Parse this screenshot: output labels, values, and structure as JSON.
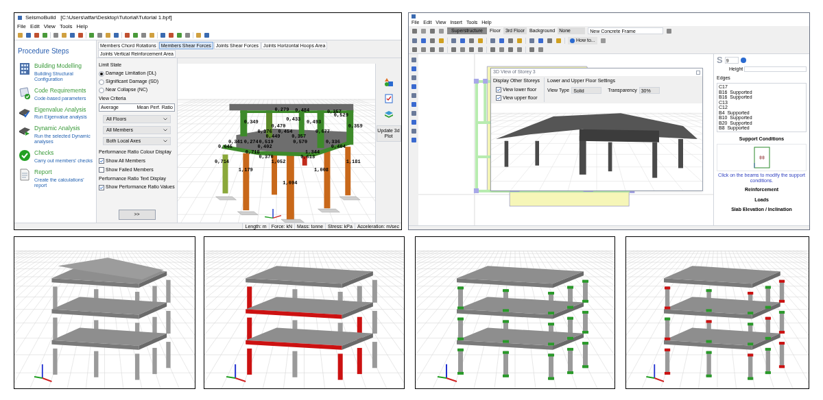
{
  "left_window": {
    "title": "SeismoBuild   [C:\\Users\\atfar\\Desktop\\Tutorial\\Tutorial 1.bpf]",
    "menu": [
      "File",
      "Edit",
      "View",
      "Tools",
      "Help"
    ],
    "sidebar": {
      "heading": "Procedure Steps",
      "steps": [
        {
          "title": "Building Modelling",
          "subtitle": "Building Structural Configuration"
        },
        {
          "title": "Code Requirements",
          "subtitle": "Code-based parameters"
        },
        {
          "title": "Eigenvalue Analysis",
          "subtitle": "Run Eigenvalue analysis"
        },
        {
          "title": "Dynamic Analysis",
          "subtitle": "Run the selected Dynamic analyses"
        },
        {
          "title": "Checks",
          "subtitle": "Carry out members' checks"
        },
        {
          "title": "Report",
          "subtitle": "Create the calculations' report"
        }
      ]
    },
    "tabs": [
      {
        "label": "Members Chord Rotations",
        "selected": false
      },
      {
        "label": "Members Shear Forces",
        "selected": true
      },
      {
        "label": "Joints Shear Forces",
        "selected": false
      },
      {
        "label": "Joints Horizontal Hoops Area",
        "selected": false
      },
      {
        "label": "Joints Vertical Reinforcement Area",
        "selected": false
      }
    ],
    "limit_state": {
      "label": "Limit State",
      "options": [
        {
          "label": "Damage Limitation (DL)",
          "selected": true
        },
        {
          "label": "Significant Damage (SD)",
          "selected": false
        },
        {
          "label": "Near Collapse (NC)",
          "selected": false
        }
      ]
    },
    "view_criteria": {
      "label": "View Criteria",
      "average": "Average",
      "mode": "Mean Perf. Ratio",
      "dropdowns": [
        "All Floors",
        "All Members",
        "Both Local Axes"
      ]
    },
    "colour_display": {
      "label": "Performance Ratio Colour Display",
      "options": [
        {
          "label": "Show All Members",
          "checked": true
        },
        {
          "label": "Show Failed Members",
          "checked": false
        }
      ]
    },
    "text_display": {
      "label": "Performance Ratio Text Display",
      "options": [
        {
          "label": "Show Performance Ratio Values",
          "checked": true
        }
      ]
    },
    "next_button": ">>",
    "ratio_labels": [
      "0,279",
      "0,484",
      "0,357",
      "0,529",
      "0,433",
      "0,349",
      "0,493",
      "0,470",
      "0,359",
      "0,376",
      "0,454",
      "0,677",
      "0,449",
      "0,357",
      "0,341",
      "0,274",
      "0,519",
      "0,570",
      "0,336",
      "0,645",
      "0,402",
      "0,404",
      "0,718",
      "1,344",
      "0,370",
      "0,613",
      "0,714",
      "1,052",
      "1,181",
      "1,179",
      "1,008",
      "1,094"
    ],
    "update_button": "Update 3d Plot",
    "status_bar": [
      "Length: m",
      "Force: kN",
      "Mass: tonne",
      "Stress: kPa",
      "Acceleration: m/sec"
    ]
  },
  "right_window": {
    "menu": [
      "File",
      "Edit",
      "View",
      "Insert",
      "Tools",
      "Help"
    ],
    "toolbar": {
      "mode": "Superstructure",
      "floor_label": "Floor",
      "floor": "3rd Floor",
      "background_label": "Background",
      "background": "None",
      "element": "New Concrete Frame",
      "help_button": "How to..."
    },
    "dialog": {
      "title": "3D View of Storey 3",
      "storeys_label": "Display Other Storeys",
      "options": [
        {
          "label": "View lower floor",
          "checked": true
        },
        {
          "label": "View upper floor",
          "checked": true
        }
      ],
      "settings_label": "Lower and Upper Floor Settings",
      "view_type_label": "View Type",
      "view_type": "Solid",
      "transparency_label": "Transparency",
      "transparency": "30%"
    },
    "properties": {
      "letter": "S",
      "number": "9",
      "height_label": "Height",
      "edges_label": "Edges",
      "edges": [
        "C17",
        "B16  Supported",
        "B16  Supported",
        "C13",
        "C12",
        "B4  Supported",
        "B10  Supported",
        "B20  Supported",
        "B8  Supported"
      ],
      "support_heading": "Support Conditions",
      "support_hint": "Click on the beams to modify the support conditions.",
      "reinforcement_heading": "Reinforcement",
      "loads_heading": "Loads",
      "slab_heading": "Slab Elevation / Inclination"
    }
  },
  "renders": [
    {
      "kind": "plain"
    },
    {
      "kind": "failed_members"
    },
    {
      "kind": "hinges_safe"
    },
    {
      "kind": "hinges_mixed"
    }
  ]
}
